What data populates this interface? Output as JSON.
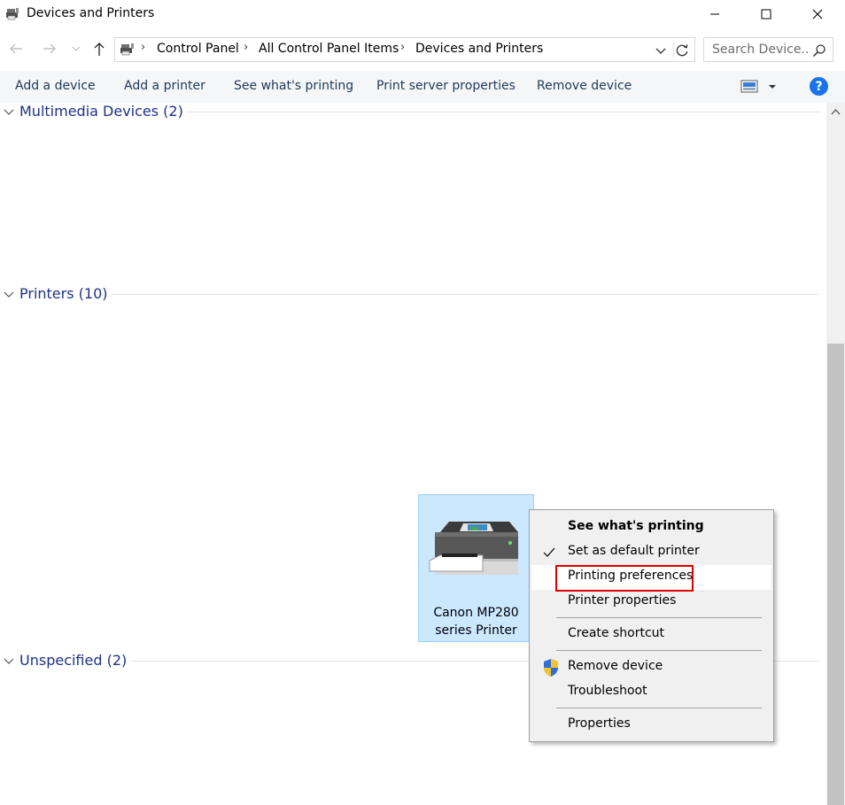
{
  "window": {
    "title": "Devices and Printers"
  },
  "address": {
    "breadcrumbs": [
      "Control Panel",
      "All Control Panel Items",
      "Devices and Printers"
    ],
    "search_placeholder": "Search Device..."
  },
  "toolbar": {
    "add_device": "Add a device",
    "add_printer": "Add a printer",
    "see_printing": "See what's printing",
    "print_server": "Print server properties",
    "remove_device": "Remove device",
    "help": "?"
  },
  "groups": {
    "multimedia": "Multimedia Devices (2)",
    "printers": "Printers (10)",
    "unspecified": "Unspecified (2)"
  },
  "printer": {
    "label_line1": "Canon MP280",
    "label_line2": "series Printer"
  },
  "context_menu": {
    "see_printing": "See what's printing",
    "set_default": "Set as default printer",
    "printing_prefs": "Printing preferences",
    "printer_props": "Printer properties",
    "create_shortcut": "Create shortcut",
    "remove_device": "Remove device",
    "troubleshoot": "Troubleshoot",
    "properties": "Properties"
  },
  "colors": {
    "group_header": "#1e3287",
    "selection": "#cce8ff",
    "highlight_box": "#e00000",
    "help_button": "#1a73e8"
  }
}
